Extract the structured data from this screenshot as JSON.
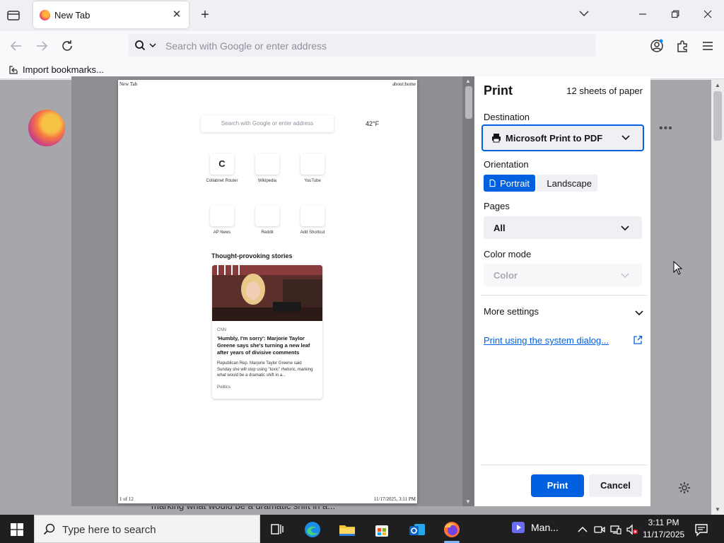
{
  "browser": {
    "tab_title": "New Tab",
    "url_placeholder": "Search with Google or enter address",
    "bookmark_label": "Import bookmarks..."
  },
  "background": {
    "snippet": "marking what would be a dramatic shift in a..."
  },
  "preview": {
    "header_left": "New Tab",
    "header_right": "about:home",
    "footer_left": "1 of 12",
    "footer_right": "11/17/2025, 3:11 PM",
    "search_placeholder": "Search with Google or enter address",
    "weather": "42°F",
    "shortcuts": [
      {
        "label": "Collabnet Router",
        "letter": "C"
      },
      {
        "label": "Wikipedia",
        "letter": ""
      },
      {
        "label": "YouTube",
        "letter": ""
      },
      {
        "label": "AP News",
        "letter": ""
      },
      {
        "label": "Reddit",
        "letter": ""
      },
      {
        "label": "Add Shortcut",
        "letter": ""
      }
    ],
    "stories_heading": "Thought-provoking stories",
    "story": {
      "source": "CNN",
      "title": "'Humbly, I'm sorry': Marjorie Taylor Greene says she's turning a new leaf after years of divisive comments",
      "description": "Republican Rep. Marjorie Taylor Greene said Sunday she will stop using \"toxic\" rhetoric, marking what would be a dramatic shift in a...",
      "category": "Politics"
    }
  },
  "print_panel": {
    "title": "Print",
    "sheets": "12 sheets of paper",
    "destination_label": "Destination",
    "destination_value": "Microsoft Print to PDF",
    "orientation_label": "Orientation",
    "portrait": "Portrait",
    "landscape": "Landscape",
    "pages_label": "Pages",
    "pages_value": "All",
    "color_label": "Color mode",
    "color_value": "Color",
    "more_settings": "More settings",
    "system_dialog": "Print using the system dialog...",
    "print_button": "Print",
    "cancel_button": "Cancel"
  },
  "taskbar": {
    "search_placeholder": "Type here to search",
    "app_label": "Man...",
    "time": "3:11 PM",
    "date": "11/17/2025"
  },
  "colors": {
    "accent": "#0061e0",
    "taskbar": "#1f1f1f"
  }
}
